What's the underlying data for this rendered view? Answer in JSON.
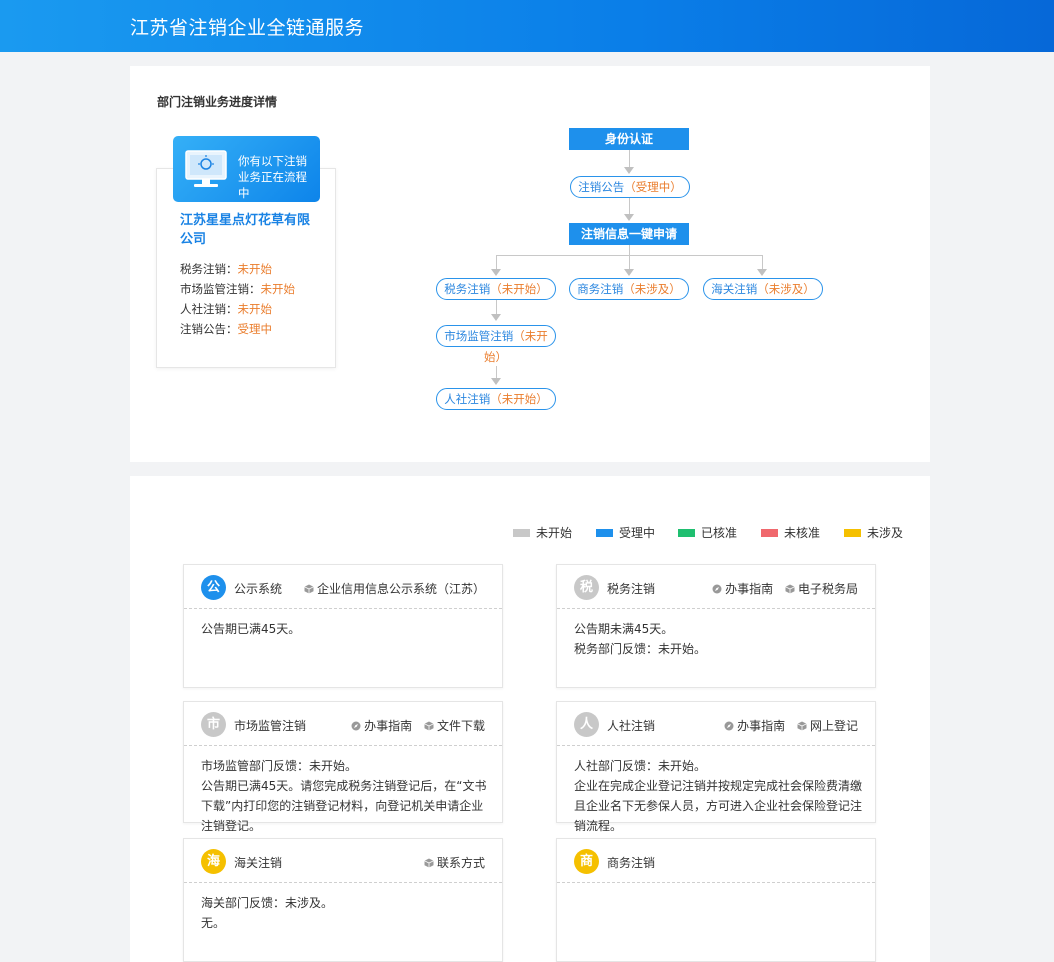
{
  "header": {
    "title": "江苏省注销企业全链通服务"
  },
  "progress": {
    "heading": "部门注销业务进度详情",
    "banner_text": "你有以下注销业务正在流程中",
    "company_name": "江苏星星点灯花草有限公司",
    "statuses": [
      {
        "label": "税务注销：",
        "value": "未开始"
      },
      {
        "label": "市场监管注销：",
        "value": "未开始"
      },
      {
        "label": "人社注销：",
        "value": "未开始"
      },
      {
        "label": "注销公告：",
        "value": "受理中"
      }
    ]
  },
  "flow": {
    "identity": "身份认证",
    "announce": {
      "label": "注销公告",
      "status": "（受理中）"
    },
    "apply": "注销信息一键申请",
    "tax": {
      "label": "税务注销",
      "status": "（未开始）"
    },
    "commerce": {
      "label": "商务注销",
      "status": "（未涉及）"
    },
    "customs": {
      "label": "海关注销",
      "status": "（未涉及）"
    },
    "market": {
      "label": "市场监管注销",
      "status_a": "（未开",
      "status_b": "始）"
    },
    "social": {
      "label": "人社注销",
      "status": "（未开始）"
    }
  },
  "legend": [
    {
      "label": "未开始",
      "color": "#c8c8c8"
    },
    {
      "label": "受理中",
      "color": "#1e90ec"
    },
    {
      "label": "已核准",
      "color": "#1fbf70"
    },
    {
      "label": "未核准",
      "color": "#f0686d"
    },
    {
      "label": "未涉及",
      "color": "#f5c000"
    }
  ],
  "cards": {
    "gongshi": {
      "icon": "公",
      "color": "#1e90ec",
      "title": "公示系统",
      "links": [
        "企业信用信息公示系统（江苏）"
      ],
      "lines": [
        "公告期已满45天。"
      ]
    },
    "shuiwu": {
      "icon": "税",
      "color": "#c8c8c8",
      "title": "税务注销",
      "links": [
        "办事指南",
        "电子税务局"
      ],
      "lines": [
        "公告期未满45天。",
        "税务部门反馈：未开始。"
      ]
    },
    "shichang": {
      "icon": "市",
      "color": "#c8c8c8",
      "title": "市场监管注销",
      "links": [
        "办事指南",
        "文件下载"
      ],
      "lines": [
        "市场监管部门反馈：未开始。",
        "公告期已满45天。请您完成税务注销登记后，在“文书下载”内打印您的注销登记材料，向登记机关申请企业注销登记。"
      ]
    },
    "renshe": {
      "icon": "人",
      "color": "#c8c8c8",
      "title": "人社注销",
      "links": [
        "办事指南",
        "网上登记"
      ],
      "lines": [
        "人社部门反馈：未开始。",
        "企业在完成企业登记注销并按规定完成社会保险费清缴且企业名下无参保人员，方可进入企业社会保险登记注销流程。"
      ]
    },
    "haiguan": {
      "icon": "海",
      "color": "#f5c000",
      "title": "海关注销",
      "links": [
        "联系方式"
      ],
      "lines": [
        "海关部门反馈：未涉及。",
        "无。"
      ]
    },
    "shangwu": {
      "icon": "商",
      "color": "#f5c000",
      "title": "商务注销",
      "links": [],
      "lines": []
    }
  }
}
